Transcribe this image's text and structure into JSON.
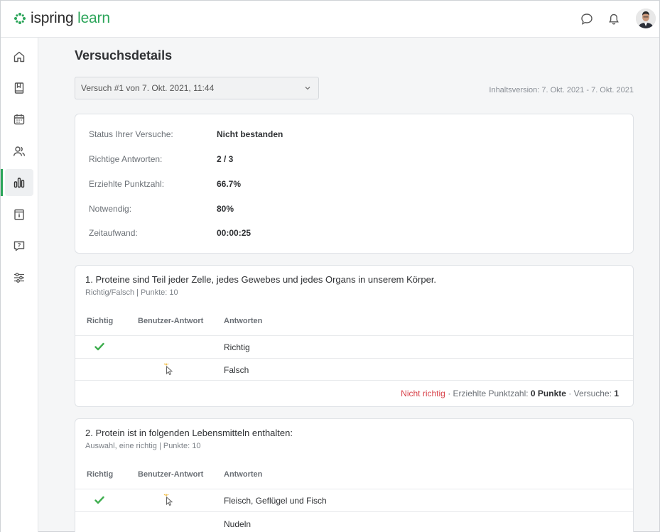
{
  "brand": {
    "logo_word1": "ispring",
    "logo_word2": "learn",
    "accent": "#2ca55a"
  },
  "topbar": {
    "icons": [
      "chat-icon",
      "bell-icon",
      "user-avatar"
    ]
  },
  "sidebar": {
    "items": [
      {
        "name": "home-icon"
      },
      {
        "name": "book-icon"
      },
      {
        "name": "calendar-icon"
      },
      {
        "name": "users-icon"
      },
      {
        "name": "reports-icon",
        "active": true
      },
      {
        "name": "info-card-icon"
      },
      {
        "name": "question-icon"
      },
      {
        "name": "settings-sliders-icon"
      }
    ]
  },
  "page": {
    "title": "Versuchsdetails",
    "attempt_select": "Versuch #1 von 7. Okt. 2021, 11:44",
    "content_version": "Inhaltsversion: 7. Okt. 2021 - 7. Okt. 2021"
  },
  "summary": {
    "rows": [
      {
        "label": "Status Ihrer Versuche:",
        "value": "Nicht bestanden"
      },
      {
        "label": "Richtige Antworten:",
        "value": "2 / 3"
      },
      {
        "label": "Erziehlte Punktzahl:",
        "value": "66.7%"
      },
      {
        "label": "Notwendig:",
        "value": "80%"
      },
      {
        "label": "Zeitaufwand:",
        "value": "00:00:25"
      }
    ]
  },
  "table_headers": {
    "correct": "Richtig",
    "user_answer": "Benutzer-Antwort",
    "answers": "Antworten"
  },
  "questions": [
    {
      "title": "1. Proteine sind Teil jeder Zelle, jedes Gewebes und jedes Organs in unserem Körper.",
      "meta": "Richtig/Falsch | Punkte: 10",
      "answers": [
        {
          "text": "Richtig",
          "correct": true,
          "user": false
        },
        {
          "text": "Falsch",
          "correct": false,
          "user": true
        }
      ],
      "footer": {
        "status": "Nicht richtig",
        "score_label": " · Erziehlte Punktzahl: ",
        "score": "0 Punkte",
        "attempts_label": " · Versuche: ",
        "attempts": "1"
      }
    },
    {
      "title": "2. Protein ist in folgenden Lebensmitteln enthalten:",
      "meta": "Auswahl, eine richtig | Punkte: 10",
      "answers": [
        {
          "text": "Fleisch, Geflügel und Fisch",
          "correct": true,
          "user": true
        },
        {
          "text": "Nudeln",
          "correct": false,
          "user": false
        }
      ]
    }
  ]
}
